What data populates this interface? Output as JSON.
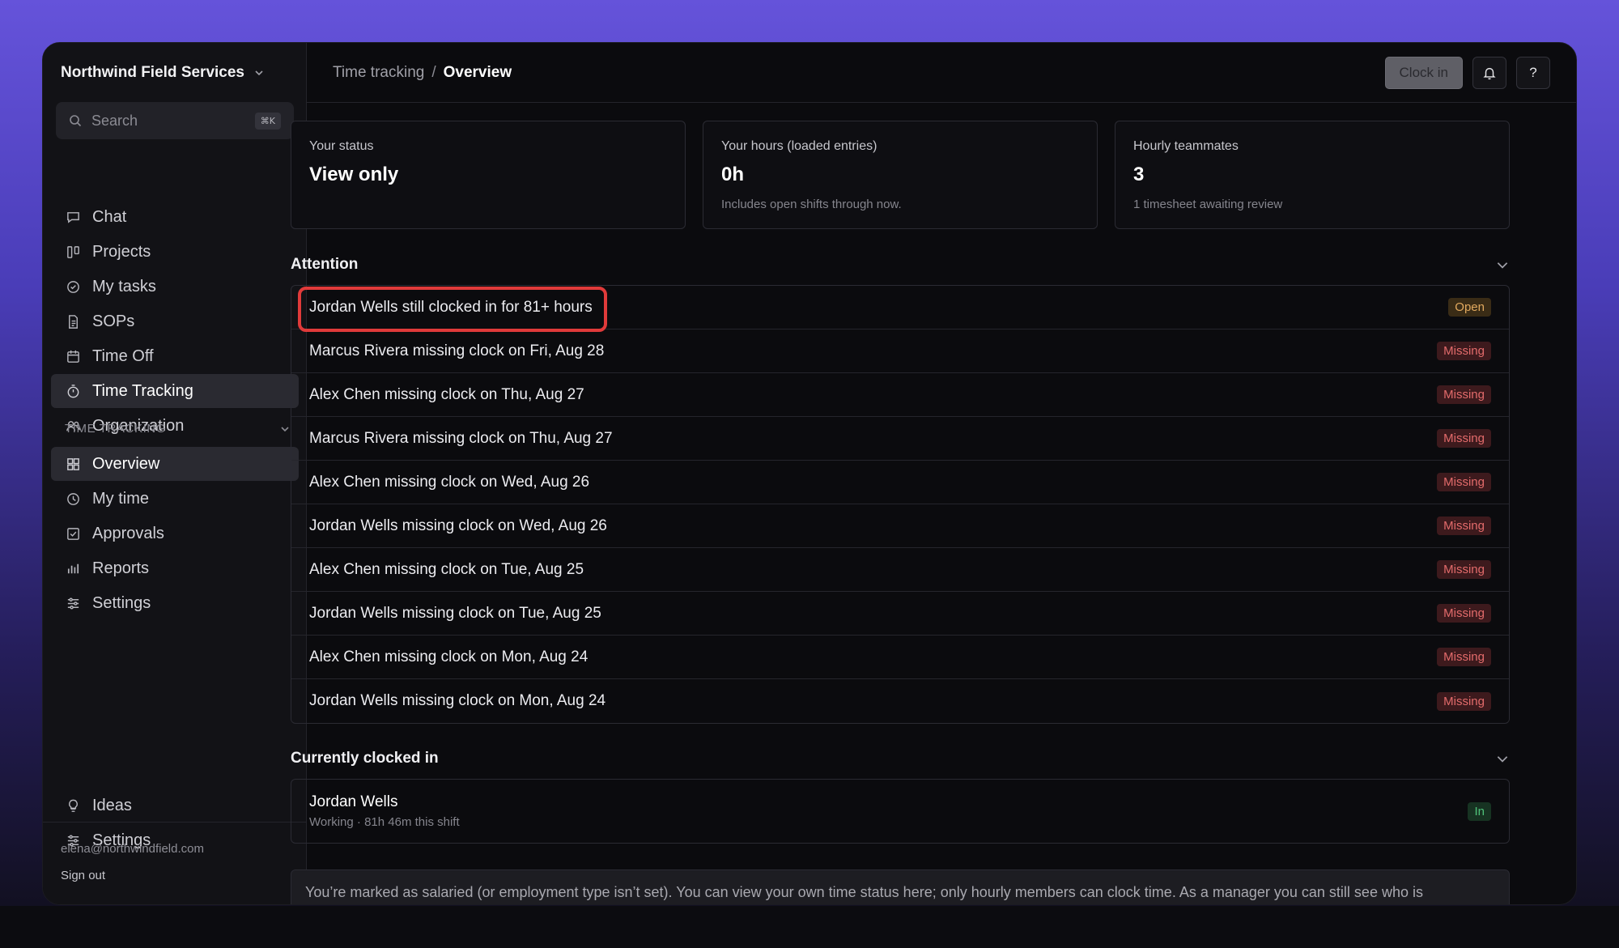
{
  "sidebar": {
    "workspace": "Northwind Field Services",
    "search_placeholder": "Search",
    "search_shortcut": "⌘K",
    "primary_items": [
      {
        "label": "Chat",
        "icon": "chat-icon"
      },
      {
        "label": "Projects",
        "icon": "kanban-icon"
      },
      {
        "label": "My tasks",
        "icon": "check-circle-icon"
      },
      {
        "label": "SOPs",
        "icon": "document-icon"
      },
      {
        "label": "Time Off",
        "icon": "calendar-icon"
      },
      {
        "label": "Time Tracking",
        "icon": "stopwatch-icon",
        "active": true
      },
      {
        "label": "Organization",
        "icon": "users-icon"
      }
    ],
    "section_label": "TIME TRACKING",
    "section_items": [
      {
        "label": "Overview",
        "icon": "grid-icon",
        "active": true
      },
      {
        "label": "My time",
        "icon": "clock-icon"
      },
      {
        "label": "Approvals",
        "icon": "checkbox-icon"
      },
      {
        "label": "Reports",
        "icon": "bar-chart-icon"
      },
      {
        "label": "Settings",
        "icon": "sliders-icon"
      }
    ],
    "bottom_items": [
      {
        "label": "Ideas",
        "icon": "lightbulb-icon"
      },
      {
        "label": "Settings",
        "icon": "sliders-icon"
      }
    ],
    "user_email": "elena@northwindfield.com",
    "sign_out": "Sign out"
  },
  "header": {
    "breadcrumb_parent": "Time tracking",
    "breadcrumb_separator": "/",
    "breadcrumb_current": "Overview",
    "clock_in_label": "Clock in",
    "help_label": "?"
  },
  "stats": [
    {
      "label": "Your status",
      "value": "View only",
      "sub": ""
    },
    {
      "label": "Your hours (loaded entries)",
      "value": "0h",
      "sub": "Includes open shifts through now."
    },
    {
      "label": "Hourly teammates",
      "value": "3",
      "sub": "1 timesheet awaiting review"
    }
  ],
  "attention": {
    "title": "Attention",
    "items": [
      {
        "text": "Jordan Wells still clocked in for 81+ hours",
        "badge": "Open",
        "type": "open"
      },
      {
        "text": "Marcus Rivera missing clock on Fri, Aug 28",
        "badge": "Missing",
        "type": "missing"
      },
      {
        "text": "Alex Chen missing clock on Thu, Aug 27",
        "badge": "Missing",
        "type": "missing"
      },
      {
        "text": "Marcus Rivera missing clock on Thu, Aug 27",
        "badge": "Missing",
        "type": "missing"
      },
      {
        "text": "Alex Chen missing clock on Wed, Aug 26",
        "badge": "Missing",
        "type": "missing"
      },
      {
        "text": "Jordan Wells missing clock on Wed, Aug 26",
        "badge": "Missing",
        "type": "missing"
      },
      {
        "text": "Alex Chen missing clock on Tue, Aug 25",
        "badge": "Missing",
        "type": "missing"
      },
      {
        "text": "Jordan Wells missing clock on Tue, Aug 25",
        "badge": "Missing",
        "type": "missing"
      },
      {
        "text": "Alex Chen missing clock on Mon, Aug 24",
        "badge": "Missing",
        "type": "missing"
      },
      {
        "text": "Jordan Wells missing clock on Mon, Aug 24",
        "badge": "Missing",
        "type": "missing"
      }
    ]
  },
  "clocked_in": {
    "title": "Currently clocked in",
    "name": "Jordan Wells",
    "detail": "Working · 81h 46m this shift",
    "badge": "In"
  },
  "notice": "You’re marked as salaried (or employment type isn’t set). You can view your own time status here; only hourly members can clock time. As a manager you can still see who is",
  "colors": {
    "accent_highlight": "#e03a3a",
    "badge_open": "#e1a95f",
    "badge_missing": "#e36b6b",
    "badge_in": "#4fc27a"
  }
}
